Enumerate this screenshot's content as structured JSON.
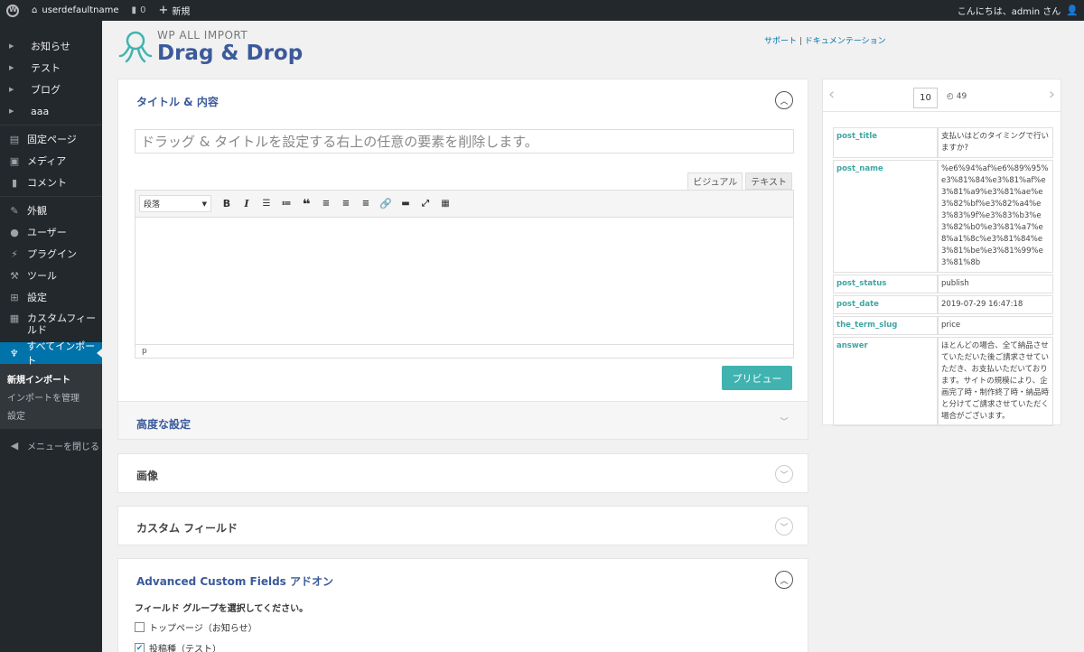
{
  "adminbar": {
    "site_name": "userdefaultname",
    "comments_count": "0",
    "new_label": "新規",
    "greeting": "こんにちは、admin さん"
  },
  "sidebar": {
    "items": [
      {
        "label": "お知らせ",
        "type": "arrow"
      },
      {
        "label": "テスト",
        "type": "arrow"
      },
      {
        "label": "ブログ",
        "type": "arrow"
      },
      {
        "label": "aaa",
        "type": "arrow"
      },
      {
        "label": "固定ページ",
        "icon": "page-icon"
      },
      {
        "label": "メディア",
        "icon": "media-icon"
      },
      {
        "label": "コメント",
        "icon": "comment-icon"
      },
      {
        "label": "外観",
        "icon": "appearance-icon"
      },
      {
        "label": "ユーザー",
        "icon": "user-icon"
      },
      {
        "label": "プラグイン",
        "icon": "plugin-icon"
      },
      {
        "label": "ツール",
        "icon": "tool-icon"
      },
      {
        "label": "設定",
        "icon": "settings-icon"
      },
      {
        "label": "カスタムフィールド",
        "icon": "custom-fields-icon"
      },
      {
        "label": "すべてインポート",
        "icon": "import-icon"
      }
    ],
    "submenu": [
      "新規インポート",
      "インポートを管理",
      "設定"
    ],
    "collapse_label": "メニューを閉じる"
  },
  "header": {
    "logo_small": "WP ALL IMPORT",
    "logo_big": "Drag & Drop",
    "support_link": "サポート",
    "docs_link": "ドキュメンテーション"
  },
  "title_panel": {
    "title": "タイトル & 内容",
    "title_placeholder": "ドラッグ & タイトルを設定する右上の任意の要素を削除します。",
    "tab_visual": "ビジュアル",
    "tab_text": "テキスト",
    "format_select": "段落",
    "status_path": "p",
    "preview_button": "プリビュー",
    "advanced_title": "高度な設定"
  },
  "image_panel": {
    "title": "画像"
  },
  "custom_fields_panel": {
    "title": "カスタム フィールド"
  },
  "acf_panel": {
    "title": "Advanced Custom Fields アドオン",
    "field_label": "フィールド グループを選択してください。",
    "options": [
      {
        "label": "トップページ（お知らせ）",
        "checked": false
      },
      {
        "label": "投稿種（テスト）",
        "checked": true
      }
    ]
  },
  "record_panel": {
    "current": "10",
    "total": "49",
    "rows": [
      {
        "key": "post_title",
        "value": "支払いはどのタイミングで行いますか?"
      },
      {
        "key": "post_name",
        "value": "%e6%94%af%e6%89%95%e3%81%84%e3%81%af%e3%81%a9%e3%81%ae%e3%82%bf%e3%82%a4%e3%83%9f%e3%83%b3%e3%82%b0%e3%81%a7%e8%a1%8c%e3%81%84%e3%81%be%e3%81%99%e3%81%8b"
      },
      {
        "key": "post_status",
        "value": "publish"
      },
      {
        "key": "post_date",
        "value": "2019-07-29 16:47:18"
      },
      {
        "key": "the_term_slug",
        "value": "price"
      },
      {
        "key": "answer",
        "value": "ほとんどの場合、全て納品させていただいた後ご請求させていただき、お支払いただいております。サイトの規模により、企画完了時・制作終了時・納品時と分けてご請求させていただく場合がございます。"
      }
    ]
  }
}
